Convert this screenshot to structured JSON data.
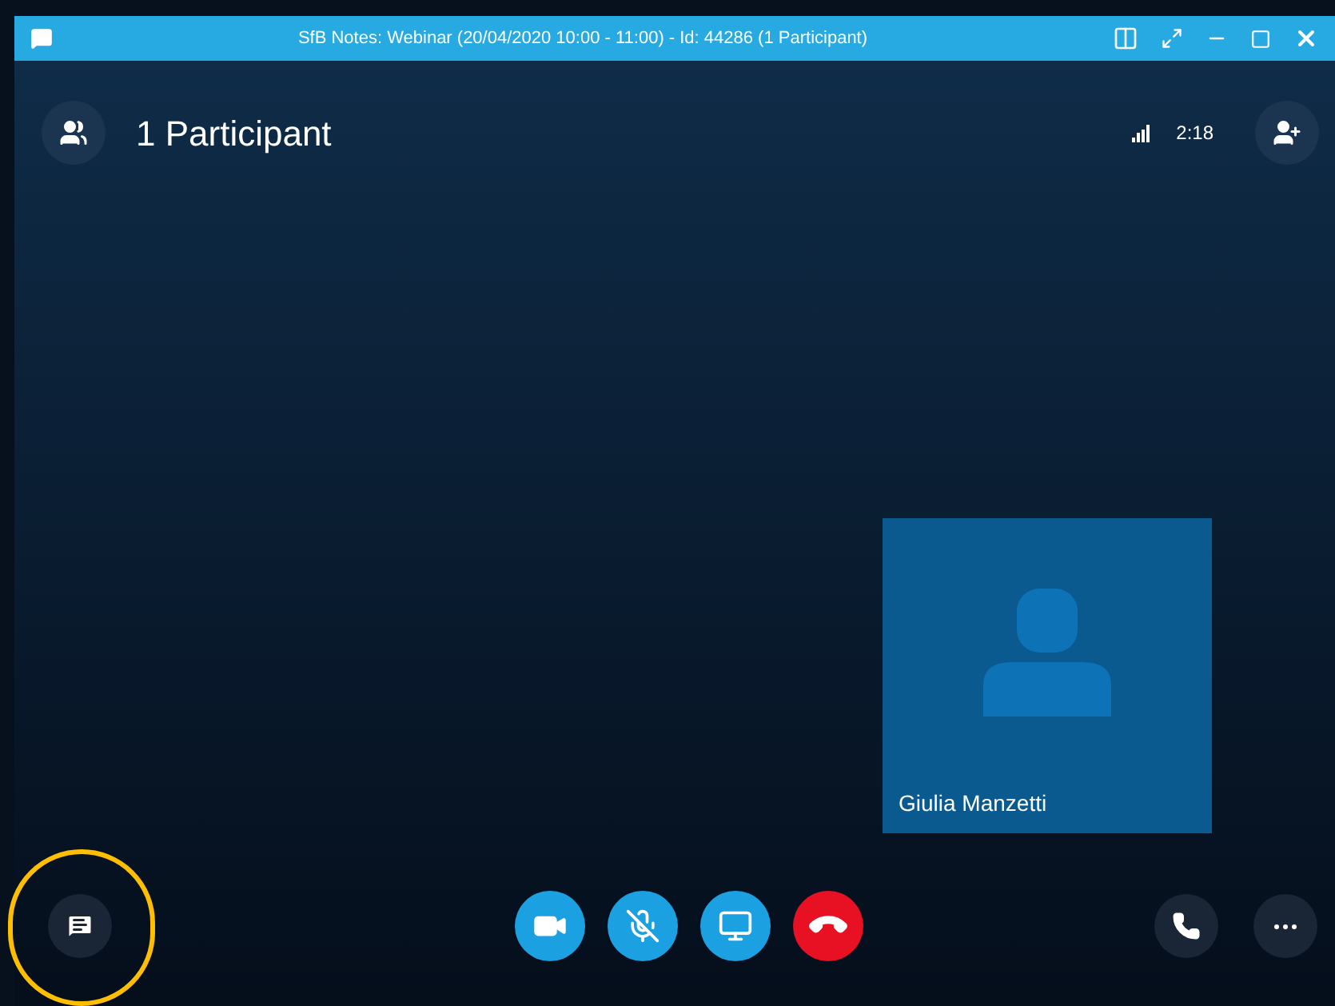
{
  "window": {
    "title": "SfB Notes: Webinar (20/04/2020 10:00 -  11:00) - Id: 44286 (1 Participant)"
  },
  "header": {
    "participants": "1 Participant",
    "duration": "2:18"
  },
  "tile": {
    "name": "Giulia Manzetti"
  },
  "controls": [
    {
      "kind": "video"
    },
    {
      "kind": "mic",
      "muted": true
    },
    {
      "kind": "share"
    },
    {
      "kind": "hangup"
    }
  ],
  "chat": {
    "highlighted": true
  }
}
